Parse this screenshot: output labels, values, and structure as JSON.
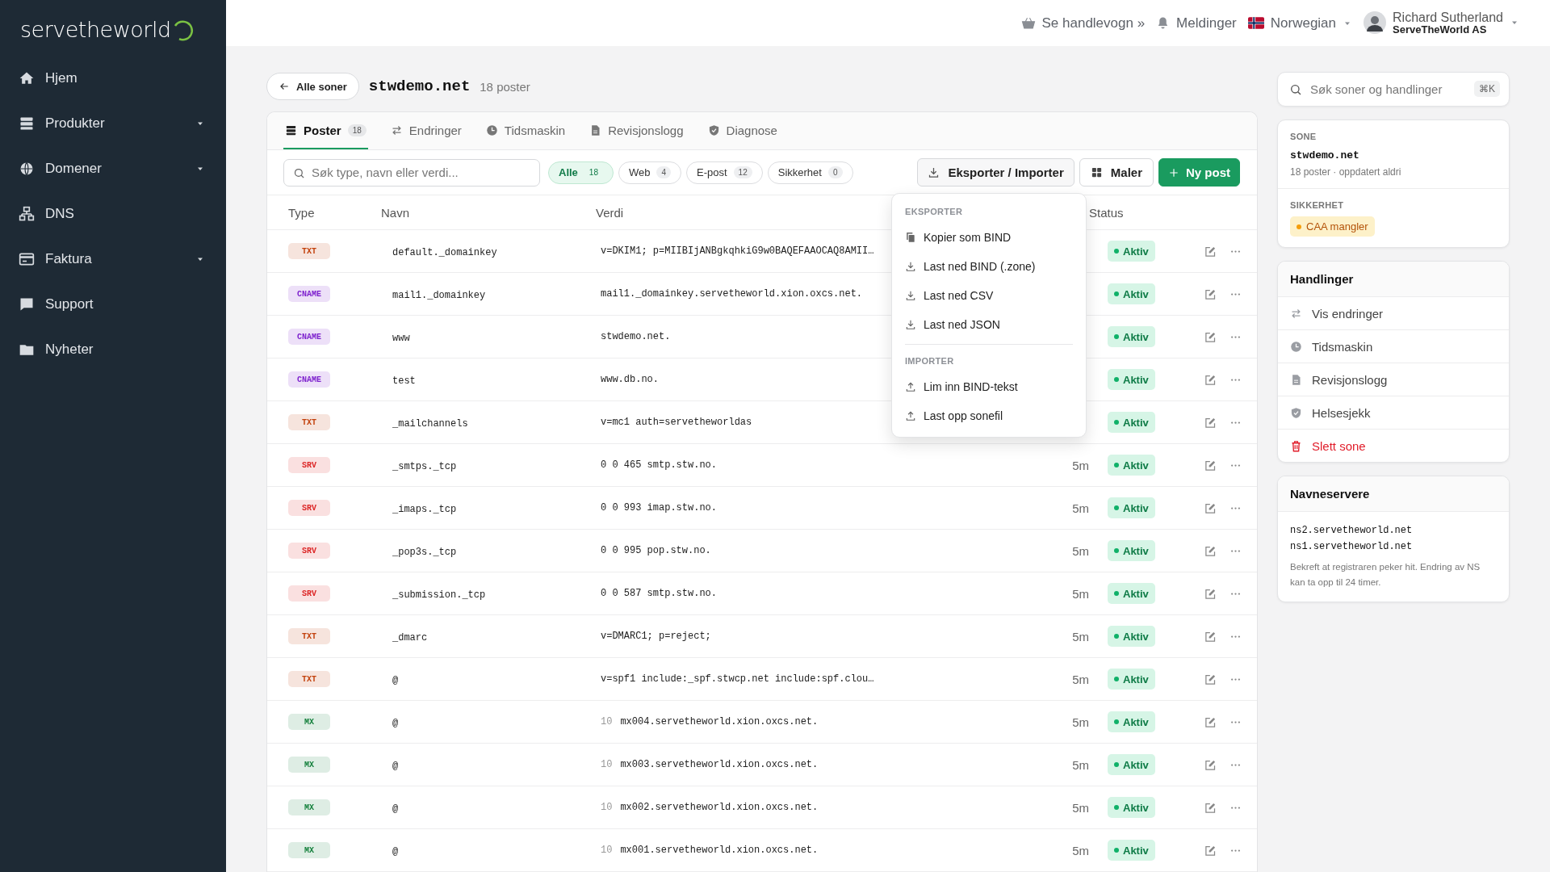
{
  "sidebar": {
    "logo": "servetheworld",
    "items": [
      {
        "label": "Hjem",
        "expandable": false
      },
      {
        "label": "Produkter",
        "expandable": true
      },
      {
        "label": "Domener",
        "expandable": true
      },
      {
        "label": "DNS",
        "expandable": false
      },
      {
        "label": "Faktura",
        "expandable": true
      },
      {
        "label": "Support",
        "expandable": false
      },
      {
        "label": "Nyheter",
        "expandable": false
      }
    ]
  },
  "topbar": {
    "cart": "Se handlevogn »",
    "notifications": "Meldinger",
    "language": "Norwegian",
    "user": {
      "name": "Richard Sutherland",
      "company": "ServeTheWorld AS"
    }
  },
  "zone": {
    "back": "Alle soner",
    "name": "stwdemo.net",
    "count": "18 poster"
  },
  "tabs": [
    {
      "label": "Poster",
      "count": "18",
      "selected": true
    },
    {
      "label": "Endringer",
      "selected": false
    },
    {
      "label": "Tidsmaskin",
      "selected": false
    },
    {
      "label": "Revisjonslogg",
      "selected": false
    },
    {
      "label": "Diagnose",
      "selected": false
    }
  ],
  "search": {
    "placeholder": "Søk type, navn eller verdi..."
  },
  "filters": [
    {
      "label": "Alle",
      "count": "18",
      "selected": true
    },
    {
      "label": "Web",
      "count": "4",
      "selected": false
    },
    {
      "label": "E-post",
      "count": "12",
      "selected": false
    },
    {
      "label": "Sikkerhet",
      "count": "0",
      "selected": false
    }
  ],
  "buttons": {
    "export": "Eksporter / Importer",
    "templates": "Maler",
    "new": "Ny post"
  },
  "export_menu": {
    "sections": [
      {
        "heading": "EKSPORTER",
        "items": [
          {
            "label": "Kopier som BIND",
            "kind": "copy"
          },
          {
            "label": "Last ned BIND (.zone)",
            "kind": "download"
          },
          {
            "label": "Last ned CSV",
            "kind": "download"
          },
          {
            "label": "Last ned JSON",
            "kind": "download"
          }
        ]
      },
      {
        "heading": "IMPORTER",
        "items": [
          {
            "label": "Lim inn BIND-tekst",
            "kind": "upload"
          },
          {
            "label": "Last opp sonefil",
            "kind": "upload"
          }
        ]
      }
    ]
  },
  "table": {
    "columns": [
      "Type",
      "Navn",
      "Verdi",
      "Status"
    ],
    "rows": [
      {
        "type": "TXT",
        "color": "#c2410c",
        "name": "default._domainkey",
        "value": "v=DKIM1; p=MIIBIjANBgkqhkiG9w0BAQEFAAOCAQ8AMII…",
        "status": "Aktiv"
      },
      {
        "type": "CNAME",
        "color": "#7e22ce",
        "name": "mail1._domainkey",
        "value": "mail1._domainkey.servetheworld.xion.oxcs.net.",
        "status": "Aktiv"
      },
      {
        "type": "CNAME",
        "color": "#7e22ce",
        "name": "www",
        "value": "stwdemo.net.",
        "status": "Aktiv"
      },
      {
        "type": "CNAME",
        "color": "#7e22ce",
        "name": "test",
        "value": "www.db.no.",
        "status": "Aktiv"
      },
      {
        "type": "TXT",
        "color": "#c2410c",
        "name": "_mailchannels",
        "value": "v=mc1 auth=servetheworldas",
        "status": "Aktiv"
      },
      {
        "type": "SRV",
        "color": "#dc2626",
        "name": "_smtps._tcp",
        "value": "0 0 465 smtp.stw.no.",
        "ttl": "5m",
        "status": "Aktiv"
      },
      {
        "type": "SRV",
        "color": "#dc2626",
        "name": "_imaps._tcp",
        "value": "0 0 993 imap.stw.no.",
        "ttl": "5m",
        "status": "Aktiv"
      },
      {
        "type": "SRV",
        "color": "#dc2626",
        "name": "_pop3s._tcp",
        "value": "0 0 995 pop.stw.no.",
        "ttl": "5m",
        "status": "Aktiv"
      },
      {
        "type": "SRV",
        "color": "#dc2626",
        "name": "_submission._tcp",
        "value": "0 0 587 smtp.stw.no.",
        "ttl": "5m",
        "status": "Aktiv"
      },
      {
        "type": "TXT",
        "color": "#c2410c",
        "name": "_dmarc",
        "value": "v=DMARC1; p=reject;",
        "ttl": "5m",
        "status": "Aktiv"
      },
      {
        "type": "TXT",
        "color": "#c2410c",
        "name": "@",
        "value": "v=spf1 include:_spf.stwcp.net include:spf.clou…",
        "ttl": "5m",
        "status": "Aktiv"
      },
      {
        "type": "MX",
        "color": "#15803d",
        "name": "@",
        "priority": "10",
        "value": "mx004.servetheworld.xion.oxcs.net.",
        "ttl": "5m",
        "status": "Aktiv"
      },
      {
        "type": "MX",
        "color": "#15803d",
        "name": "@",
        "priority": "10",
        "value": "mx003.servetheworld.xion.oxcs.net.",
        "ttl": "5m",
        "status": "Aktiv"
      },
      {
        "type": "MX",
        "color": "#15803d",
        "name": "@",
        "priority": "10",
        "value": "mx002.servetheworld.xion.oxcs.net.",
        "ttl": "5m",
        "status": "Aktiv"
      },
      {
        "type": "MX",
        "color": "#15803d",
        "name": "@",
        "priority": "10",
        "value": "mx001.servetheworld.xion.oxcs.net.",
        "ttl": "5m",
        "status": "Aktiv"
      }
    ]
  },
  "side": {
    "search": {
      "placeholder": "Søk soner og handlinger",
      "shortcut": "⌘K"
    },
    "zone_card": {
      "label": "SONE",
      "name": "stwdemo.net",
      "meta": "18 poster · oppdatert aldri",
      "security_label": "SIKKERHET",
      "security_badge": "CAA mangler"
    },
    "actions": {
      "title": "Handlinger",
      "items": [
        {
          "label": "Vis endringer",
          "kind": "normal"
        },
        {
          "label": "Tidsmaskin",
          "kind": "normal"
        },
        {
          "label": "Revisjonslogg",
          "kind": "normal"
        },
        {
          "label": "Helsesjekk",
          "kind": "normal"
        },
        {
          "label": "Slett sone",
          "kind": "danger"
        }
      ]
    },
    "nameservers": {
      "title": "Navneservere",
      "servers": [
        "ns2.servetheworld.net",
        "ns1.servetheworld.net"
      ],
      "note": "Bekreft at registraren peker hit. Endring av NS kan ta opp til 24 timer."
    }
  }
}
